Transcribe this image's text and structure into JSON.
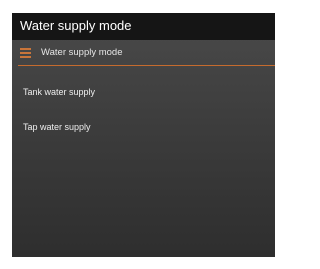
{
  "window": {
    "title": "Water supply mode"
  },
  "dialog": {
    "header_label": "Water supply mode",
    "menu_icon": "hamburger-menu-icon",
    "accent_color": "#c56b2e",
    "options": [
      {
        "label": "Tank water supply"
      },
      {
        "label": "Tap water supply"
      }
    ]
  }
}
